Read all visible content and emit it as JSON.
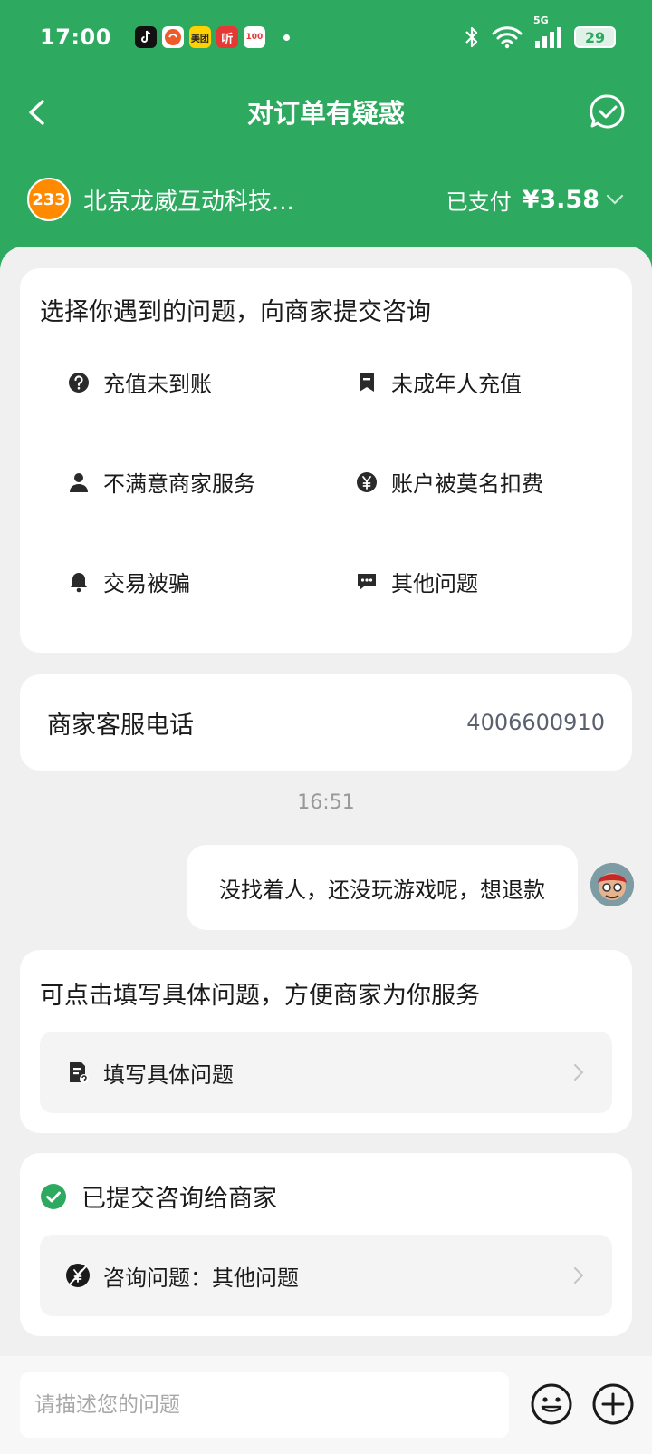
{
  "status_bar": {
    "time": "17:00",
    "network": "5G",
    "battery": "29",
    "notif": {
      "meituan": "美团",
      "ting": "听",
      "hundred": "100"
    }
  },
  "nav": {
    "title": "对订单有疑惑"
  },
  "merchant": {
    "logo_text": "233",
    "name": "北京龙威互动科技...",
    "paid_label": "已支付",
    "amount": "¥3.58"
  },
  "problems": {
    "title": "选择你遇到的问题，向商家提交咨询",
    "items": [
      {
        "label": "充值未到账",
        "icon": "question-circle-icon"
      },
      {
        "label": "未成年人充值",
        "icon": "bookmark-icon"
      },
      {
        "label": "不满意商家服务",
        "icon": "person-icon"
      },
      {
        "label": "账户被莫名扣费",
        "icon": "yen-circle-icon"
      },
      {
        "label": "交易被骗",
        "icon": "bell-icon"
      },
      {
        "label": "其他问题",
        "icon": "chat-dots-icon"
      }
    ]
  },
  "phone": {
    "label": "商家客服电话",
    "number": "4006600910"
  },
  "chat": {
    "timestamp": "16:51",
    "message": "没找着人，还没玩游戏呢，想退款"
  },
  "fill": {
    "title": "可点击填写具体问题，方便商家为你服务",
    "row_label": "填写具体问题"
  },
  "submitted": {
    "title": "已提交咨询给商家",
    "row_label": "咨询问题：其他问题"
  },
  "input": {
    "placeholder": "请描述您的问题"
  },
  "colors": {
    "brand_green": "#2eaa60",
    "background": "#f0f0f0"
  }
}
